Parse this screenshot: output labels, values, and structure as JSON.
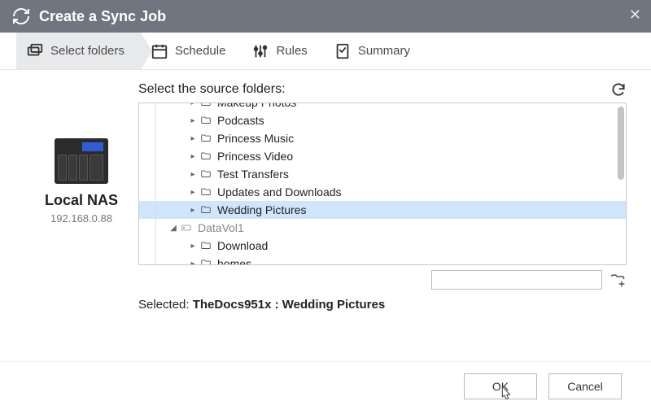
{
  "titlebar": {
    "title": "Create a Sync Job"
  },
  "steps": [
    {
      "label": "Select folders"
    },
    {
      "label": "Schedule"
    },
    {
      "label": "Rules"
    },
    {
      "label": "Summary"
    }
  ],
  "source": {
    "device_name": "Local NAS",
    "device_ip": "192.168.0.88"
  },
  "panel": {
    "heading": "Select the source folders:"
  },
  "tree": {
    "items": [
      {
        "label": "Makeup Photos",
        "level": 2,
        "type": "folder",
        "cut": true
      },
      {
        "label": "Podcasts",
        "level": 2,
        "type": "folder"
      },
      {
        "label": "Princess Music",
        "level": 2,
        "type": "folder"
      },
      {
        "label": "Princess Video",
        "level": 2,
        "type": "folder"
      },
      {
        "label": "Test Transfers",
        "level": 2,
        "type": "folder"
      },
      {
        "label": "Updates and Downloads",
        "level": 2,
        "type": "folder"
      },
      {
        "label": "Wedding Pictures",
        "level": 2,
        "type": "folder",
        "selected": true
      },
      {
        "label": "DataVol1",
        "level": 1,
        "type": "volume",
        "expanded": true
      },
      {
        "label": "Download",
        "level": 2,
        "type": "folder"
      },
      {
        "label": "homes",
        "level": 2,
        "type": "folder"
      }
    ]
  },
  "path_input": {
    "value": ""
  },
  "selected": {
    "prefix": "Selected: ",
    "path": "TheDocs951x : Wedding Pictures"
  },
  "footer": {
    "ok": "OK",
    "cancel": "Cancel"
  }
}
